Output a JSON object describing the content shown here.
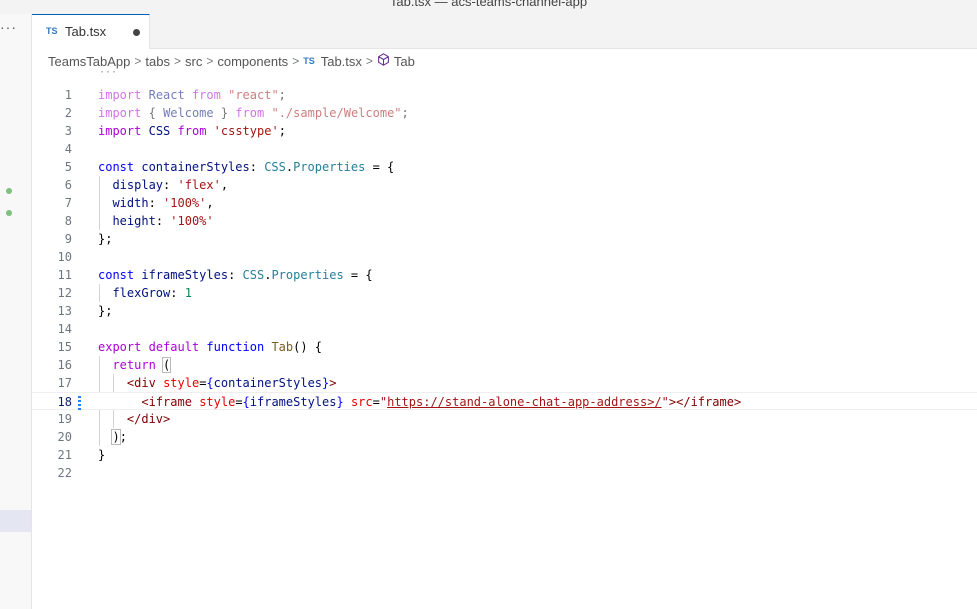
{
  "window": {
    "title": "Tab.tsx — acs-teams-channel-app"
  },
  "sidebar": {
    "more_label": "···"
  },
  "tab": {
    "lang_badge": "TS",
    "file_name": "Tab.tsx"
  },
  "breadcrumb": {
    "items": [
      "TeamsTabApp",
      "tabs",
      "src",
      "components"
    ],
    "file_badge": "TS",
    "file": "Tab.tsx",
    "symbol": "Tab",
    "separator": ">"
  },
  "editor": {
    "folded_marker": "···",
    "current_line": 18,
    "lines": [
      {
        "n": "1"
      },
      {
        "n": "2"
      },
      {
        "n": "3"
      },
      {
        "n": "4"
      },
      {
        "n": "5"
      },
      {
        "n": "6"
      },
      {
        "n": "7"
      },
      {
        "n": "8"
      },
      {
        "n": "9"
      },
      {
        "n": "10"
      },
      {
        "n": "11"
      },
      {
        "n": "12"
      },
      {
        "n": "13"
      },
      {
        "n": "14"
      },
      {
        "n": "15"
      },
      {
        "n": "16"
      },
      {
        "n": "17"
      },
      {
        "n": "18"
      },
      {
        "n": "19"
      },
      {
        "n": "20"
      },
      {
        "n": "21"
      },
      {
        "n": "22"
      }
    ],
    "tokens": {
      "import": "import",
      "from": "from",
      "React": "React",
      "react_str": "\"react\"",
      "welcome_open": "{",
      "Welcome": "Welcome",
      "welcome_close": "}",
      "welcome_str": "\"./sample/Welcome\"",
      "CSS": "CSS",
      "csstype_str": "'csstype'",
      "const": "const",
      "containerStyles": "containerStyles",
      "Properties": "Properties",
      "display": "display",
      "flex_str": "'flex'",
      "width": "width",
      "pct_str": "'100%'",
      "height": "height",
      "pct_str2": "'100%'",
      "iframeStyles": "iframeStyles",
      "flexGrow": "flexGrow",
      "one": "1",
      "export": "export",
      "default": "default",
      "function": "function",
      "Tab": "Tab",
      "return": "return",
      "div": "div",
      "style": "style",
      "iframe": "iframe",
      "src": "src",
      "url": "https://stand-alone-chat-app-address>/"
    }
  },
  "colors": {
    "accent": "#005fb8",
    "keyword": "#0000ff",
    "control": "#af00db",
    "string": "#a31515",
    "type": "#267f99",
    "variable": "#001080",
    "function": "#795e26",
    "tag": "#800000",
    "attribute": "#e50000"
  }
}
